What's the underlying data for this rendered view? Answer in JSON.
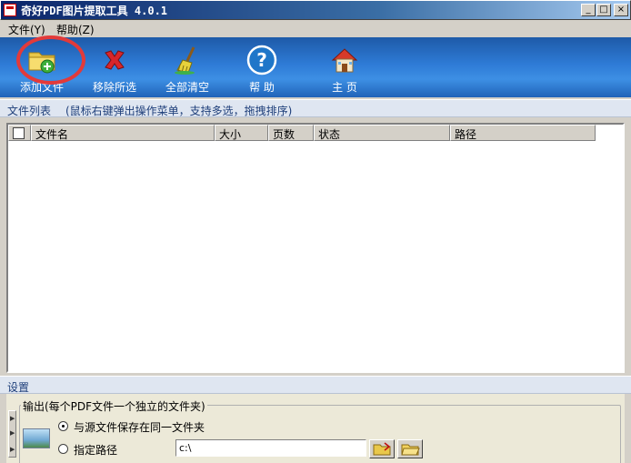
{
  "window": {
    "title": "奇好PDF图片提取工具 4.0.1"
  },
  "menu": [
    {
      "label": "文件(Y)"
    },
    {
      "label": "帮助(Z)"
    }
  ],
  "toolbar": {
    "buttons": [
      {
        "label": "添加文件",
        "icon": "add-folder-icon"
      },
      {
        "label": "移除所选",
        "icon": "red-x-icon"
      },
      {
        "label": "全部清空",
        "icon": "broom-icon"
      },
      {
        "label": "帮 助",
        "icon": "help-icon"
      },
      {
        "label": "主 页",
        "icon": "home-icon"
      }
    ]
  },
  "filelist": {
    "title": "文件列表",
    "hint": "(鼠标右键弹出操作菜单，支持多选，拖拽排序)",
    "columns": [
      "文件名",
      "大小",
      "页数",
      "状态",
      "路径"
    ]
  },
  "settings": {
    "title": "设置",
    "output_group": "输出(每个PDF文件一个独立的文件夹)",
    "option_same_folder": "与源文件保存在同一文件夹",
    "option_custom_path": "指定路径",
    "path_value": "c:\\"
  },
  "colors": {
    "toolbar": "#2e7bd6",
    "highlight": "#e23a3a",
    "section": "#dfe6f1"
  }
}
